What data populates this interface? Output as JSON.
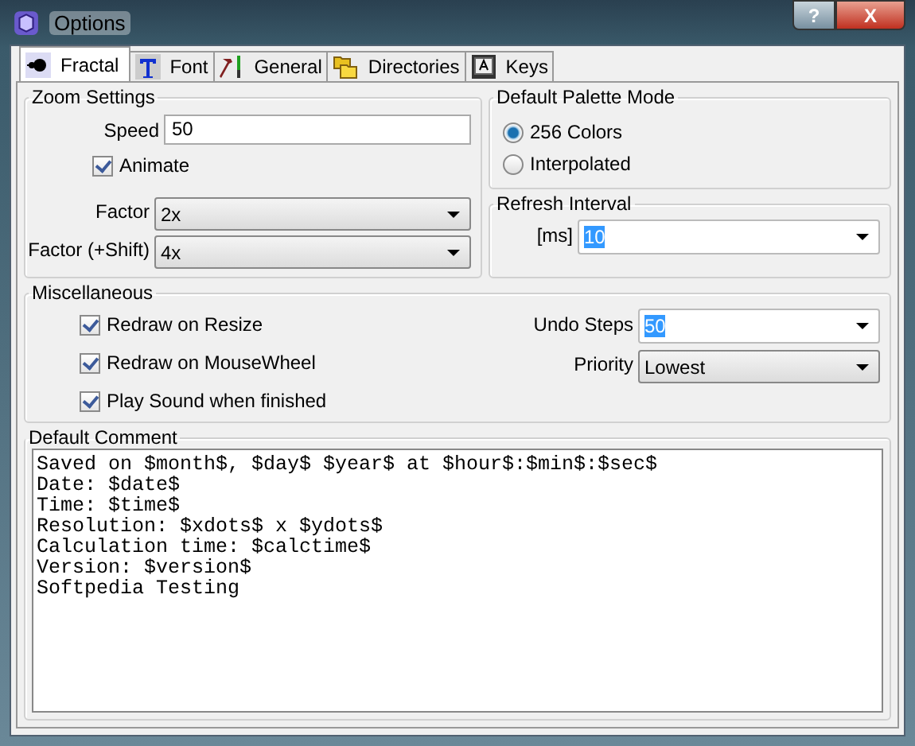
{
  "window": {
    "title": "Options",
    "buttons": [
      {
        "kind": "help",
        "label": "?"
      },
      {
        "kind": "close",
        "label": "X"
      }
    ]
  },
  "tabs": [
    {
      "label": "Fractal",
      "kind": "fractal",
      "selected": true
    },
    {
      "label": "Font",
      "kind": "font",
      "selected": false
    },
    {
      "label": "General",
      "kind": "tools",
      "selected": false
    },
    {
      "label": "Directories",
      "kind": "folders",
      "selected": false
    },
    {
      "label": "Keys",
      "kind": "key",
      "selected": false
    }
  ],
  "zoom_settings": {
    "title": "Zoom Settings",
    "speed": {
      "label": "Speed",
      "value": "50"
    },
    "animate": {
      "label": "Animate",
      "checked": true
    },
    "factor": {
      "label": "Factor",
      "value": "2x"
    },
    "factor_shift": {
      "label": "Factor (+Shift)",
      "value": "4x"
    }
  },
  "palette_mode": {
    "title": "Default Palette Mode",
    "options": [
      {
        "label": "256 Colors",
        "selected": true
      },
      {
        "label": "Interpolated",
        "selected": false
      }
    ]
  },
  "refresh_interval": {
    "title": "Refresh Interval",
    "label": "[ms]",
    "value": "10",
    "text_selected": true
  },
  "miscellaneous": {
    "title": "Miscellaneous",
    "checkboxes": [
      {
        "label": "Redraw on Resize",
        "checked": true
      },
      {
        "label": "Redraw on MouseWheel",
        "checked": true
      },
      {
        "label": "Play Sound when finished",
        "checked": true
      }
    ],
    "undo_steps": {
      "label": "Undo Steps",
      "value": "50",
      "text_selected": true
    },
    "priority": {
      "label": "Priority",
      "value": "Lowest"
    }
  },
  "default_comment": {
    "title": "Default Comment",
    "value": "Saved on $month$, $day$ $year$ at $hour$:$min$:$sec$\nDate: $date$\nTime: $time$\nResolution: $xdots$ x $ydots$\nCalculation time: $calctime$\nVersion: $version$\nSoftpedia Testing"
  }
}
